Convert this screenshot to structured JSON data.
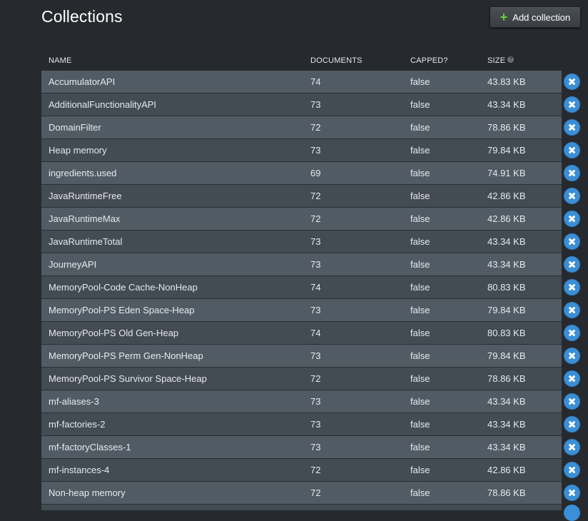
{
  "page": {
    "title": "Collections",
    "add_button_label": "Add collection",
    "add_icon": "plus-icon",
    "delete_icon": "close-circle-icon",
    "accent_color": "#3a8fd6",
    "add_icon_color": "#6fcf3a"
  },
  "table": {
    "headers": {
      "name": "NAME",
      "documents": "DOCUMENTS",
      "capped": "CAPPED?",
      "size": "SIZE",
      "size_help_icon": "help-icon"
    },
    "rows": [
      {
        "name": "AccumulatorAPI",
        "documents": "74",
        "capped": "false",
        "size": "43.83 KB"
      },
      {
        "name": "AdditionalFunctionalityAPI",
        "documents": "73",
        "capped": "false",
        "size": "43.34 KB"
      },
      {
        "name": "DomainFilter",
        "documents": "72",
        "capped": "false",
        "size": "78.86 KB"
      },
      {
        "name": "Heap memory",
        "documents": "73",
        "capped": "false",
        "size": "79.84 KB"
      },
      {
        "name": "ingredients.used",
        "documents": "69",
        "capped": "false",
        "size": "74.91 KB"
      },
      {
        "name": "JavaRuntimeFree",
        "documents": "72",
        "capped": "false",
        "size": "42.86 KB"
      },
      {
        "name": "JavaRuntimeMax",
        "documents": "72",
        "capped": "false",
        "size": "42.86 KB"
      },
      {
        "name": "JavaRuntimeTotal",
        "documents": "73",
        "capped": "false",
        "size": "43.34 KB"
      },
      {
        "name": "JourneyAPI",
        "documents": "73",
        "capped": "false",
        "size": "43.34 KB"
      },
      {
        "name": "MemoryPool-Code Cache-NonHeap",
        "documents": "74",
        "capped": "false",
        "size": "80.83 KB"
      },
      {
        "name": "MemoryPool-PS Eden Space-Heap",
        "documents": "73",
        "capped": "false",
        "size": "79.84 KB"
      },
      {
        "name": "MemoryPool-PS Old Gen-Heap",
        "documents": "74",
        "capped": "false",
        "size": "80.83 KB"
      },
      {
        "name": "MemoryPool-PS Perm Gen-NonHeap",
        "documents": "73",
        "capped": "false",
        "size": "79.84 KB"
      },
      {
        "name": "MemoryPool-PS Survivor Space-Heap",
        "documents": "72",
        "capped": "false",
        "size": "78.86 KB"
      },
      {
        "name": "mf-aliases-3",
        "documents": "73",
        "capped": "false",
        "size": "43.34 KB"
      },
      {
        "name": "mf-factories-2",
        "documents": "73",
        "capped": "false",
        "size": "43.34 KB"
      },
      {
        "name": "mf-factoryClasses-1",
        "documents": "73",
        "capped": "false",
        "size": "43.34 KB"
      },
      {
        "name": "mf-instances-4",
        "documents": "72",
        "capped": "false",
        "size": "42.86 KB"
      },
      {
        "name": "Non-heap memory",
        "documents": "72",
        "capped": "false",
        "size": "78.86 KB"
      }
    ]
  }
}
